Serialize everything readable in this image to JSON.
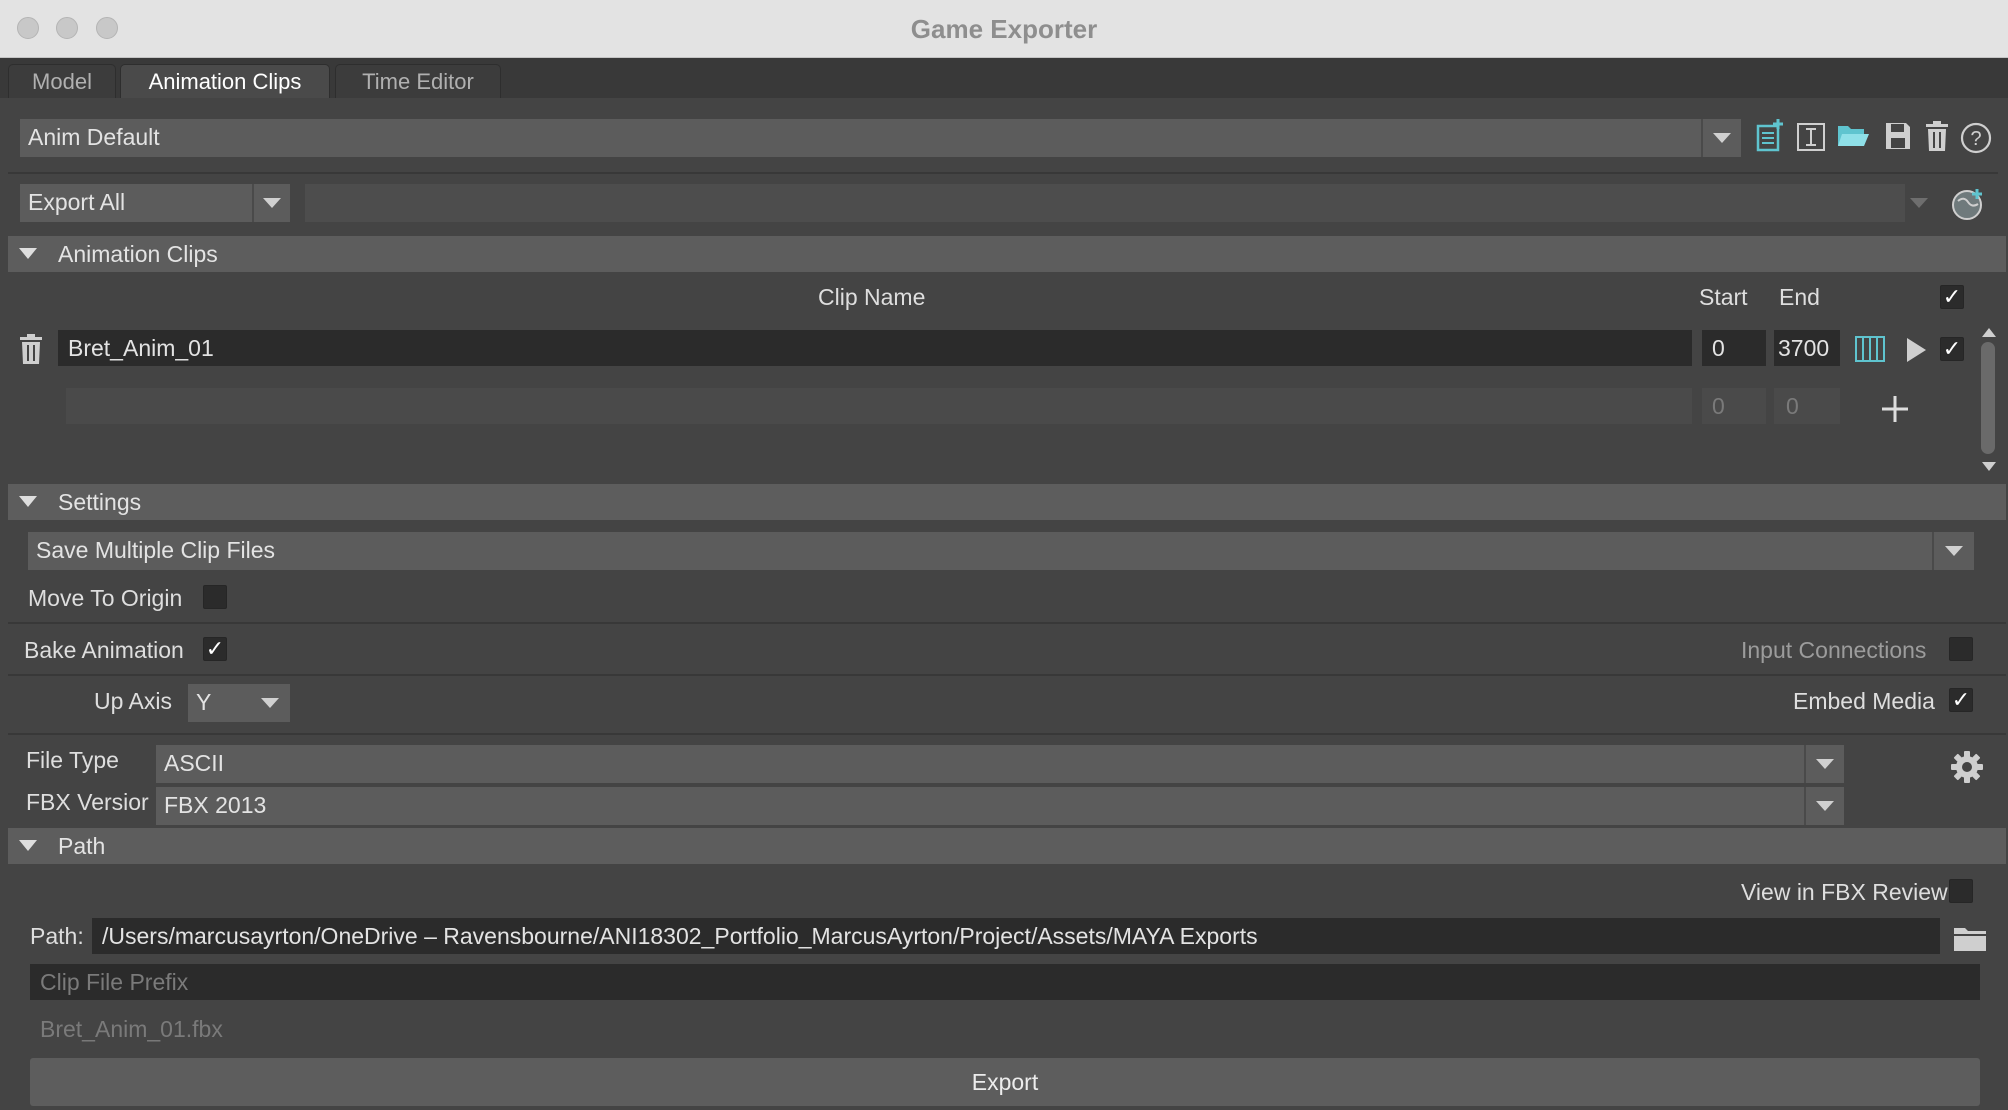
{
  "window": {
    "title": "Game Exporter"
  },
  "tabs": [
    {
      "label": "Model"
    },
    {
      "label": "Animation Clips"
    },
    {
      "label": "Time Editor"
    }
  ],
  "preset": {
    "value": "Anim Default"
  },
  "export_scope": {
    "value": "Export All",
    "selection_value": ""
  },
  "clips_section": {
    "title": "Animation Clips",
    "headers": {
      "clip_name": "Clip Name",
      "start": "Start",
      "end": "End",
      "all_checked_mark": "✓"
    },
    "rows": [
      {
        "name": "Bret_Anim_01",
        "start": "0",
        "end": "3700",
        "checked_mark": "✓"
      }
    ],
    "new_row": {
      "name": "",
      "start": "0",
      "end": "0"
    }
  },
  "settings_section": {
    "title": "Settings",
    "clip_files_mode": "Save Multiple Clip Files",
    "move_to_origin": {
      "label": "Move To Origin",
      "checked": false,
      "mark": ""
    },
    "bake_animation": {
      "label": "Bake Animation",
      "checked": true,
      "mark": "✓"
    },
    "input_connections": {
      "label": "Input Connections",
      "checked": false,
      "mark": ""
    },
    "up_axis": {
      "label": "Up Axis",
      "value": "Y"
    },
    "embed_media": {
      "label": "Embed Media",
      "checked": true,
      "mark": "✓"
    },
    "file_type": {
      "label": "File Type",
      "value": "ASCII"
    },
    "fbx_version": {
      "label": "FBX Versior",
      "value": "FBX 2013"
    }
  },
  "path_section": {
    "title": "Path",
    "view_in_fbx_review": {
      "label": "View in FBX Review",
      "checked": false,
      "mark": ""
    },
    "path_label": "Path:",
    "path_value": "/Users/marcusayrton/OneDrive – Ravensbourne/ANI18302_Portfolio_MarcusAyrton/Project/Assets/MAYA Exports",
    "clip_prefix_placeholder": "Clip File Prefix",
    "output_preview": "Bret_Anim_01.fbx"
  },
  "export_button": {
    "label": "Export"
  },
  "colors": {
    "window_bg": "#444444",
    "field_bg": "#5c5c5c",
    "dark_field_bg": "#2b2b2b",
    "section_bg": "#5d5d5d",
    "accent_teal": "#5fc4cf"
  },
  "icons": [
    "new-preset-icon",
    "rename-preset-icon",
    "load-preset-icon",
    "save-preset-icon",
    "delete-preset-icon",
    "help-icon",
    "globe-add-icon",
    "trash-icon",
    "time-slider-icon",
    "play-icon",
    "add-icon",
    "gear-icon",
    "folder-icon"
  ]
}
